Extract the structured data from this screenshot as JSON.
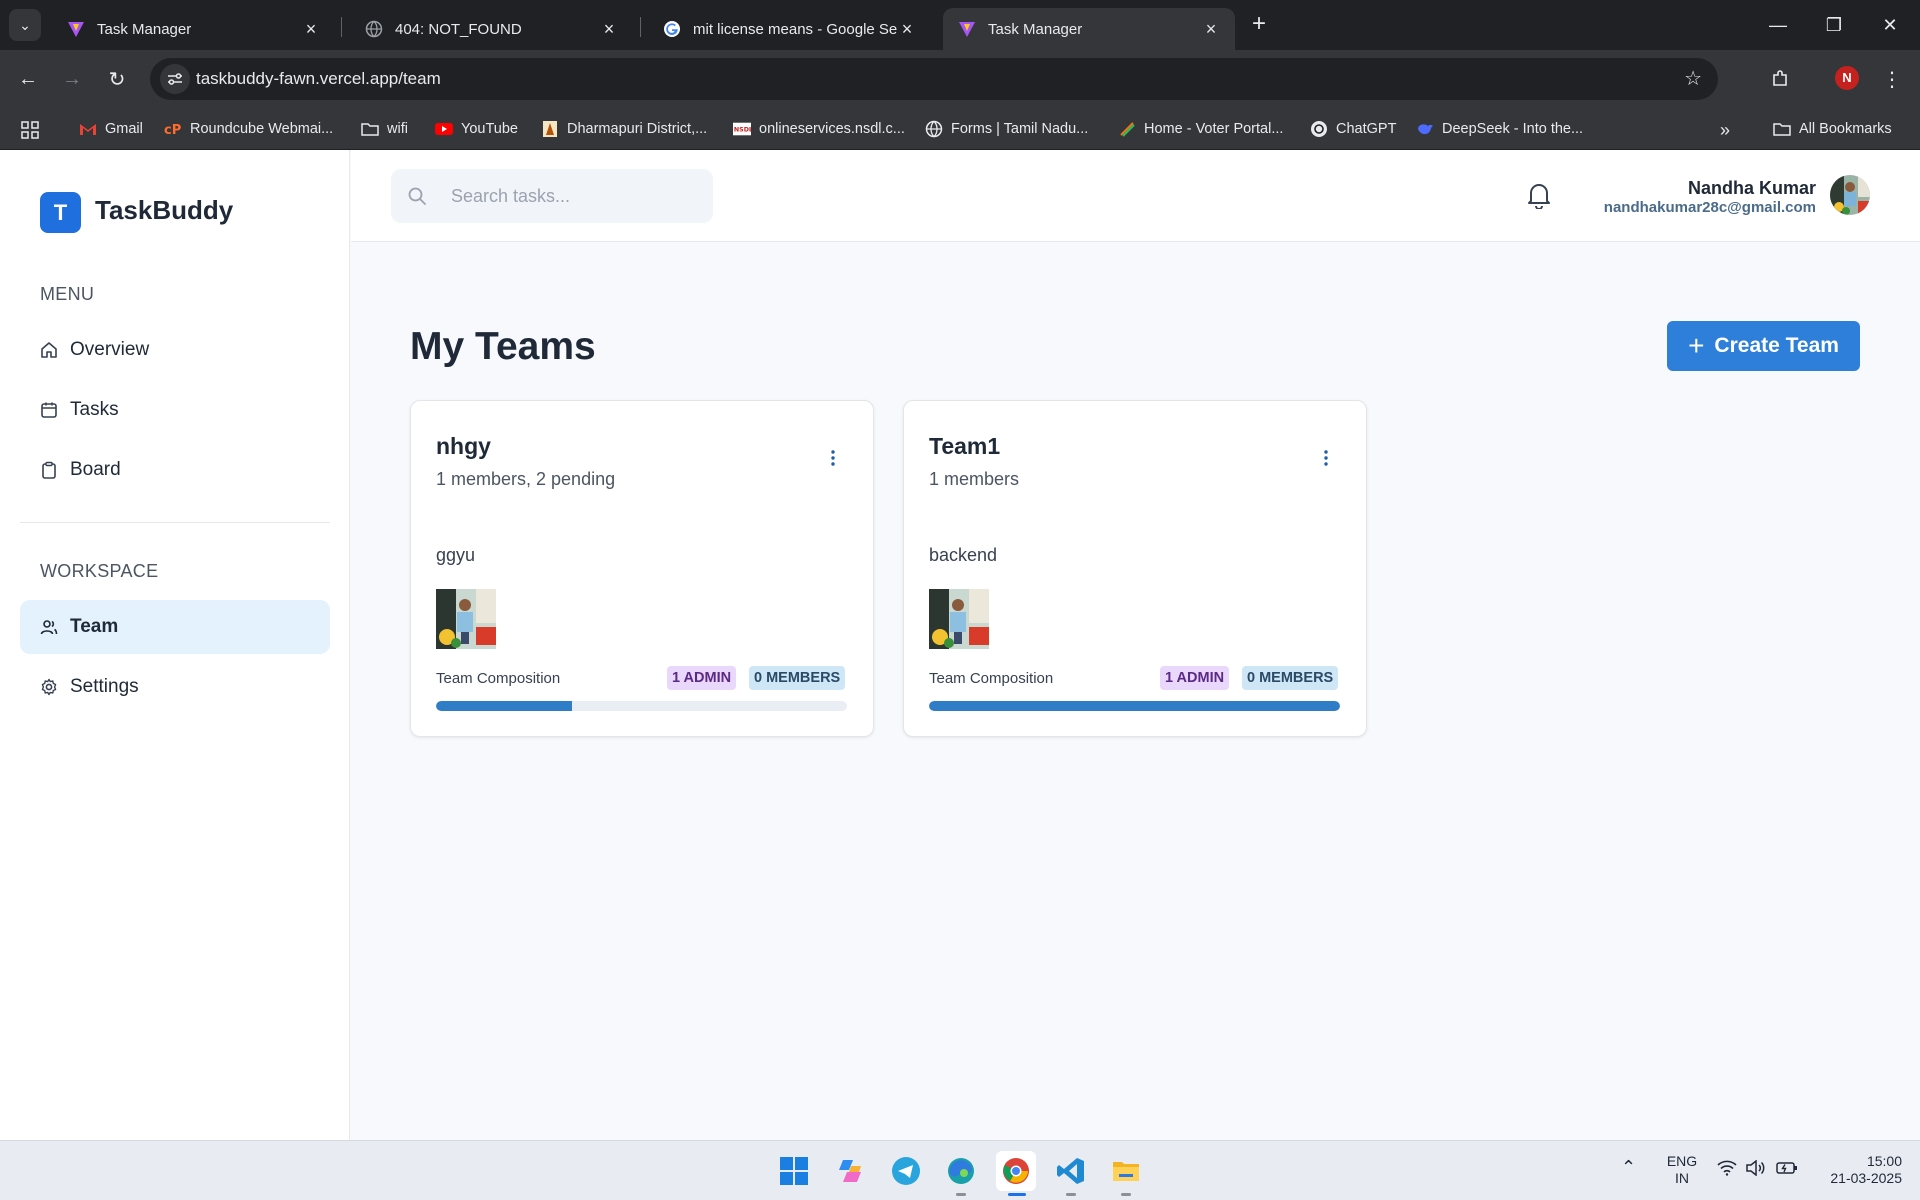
{
  "browser": {
    "tabs": [
      {
        "title": "Task Manager",
        "active": false
      },
      {
        "title": "404: NOT_FOUND",
        "active": false
      },
      {
        "title": "mit license means - Google Search",
        "active": false
      },
      {
        "title": "Task Manager",
        "active": true
      }
    ],
    "url": "taskbuddy-fawn.vercel.app/team",
    "profile_initial": "N",
    "bookmarks": [
      "Gmail",
      "Roundcube Webmai...",
      "wifi",
      "YouTube",
      "Dharmapuri District,...",
      "onlineservices.nsdl.c...",
      "Forms | Tamil Nadu...",
      "Home - Voter Portal...",
      "ChatGPT",
      "DeepSeek - Into the..."
    ],
    "all_bookmarks": "All Bookmarks"
  },
  "app": {
    "brand": "TaskBuddy",
    "brand_initial": "T",
    "menu_label": "MENU",
    "menu_items": [
      "Overview",
      "Tasks",
      "Board"
    ],
    "workspace_label": "WORKSPACE",
    "workspace_items": [
      "Team",
      "Settings"
    ],
    "active_item": "Team",
    "search_placeholder": "Search tasks...",
    "user": {
      "name": "Nandha Kumar",
      "email": "nandhakumar28c@gmail.com"
    },
    "page_title": "My Teams",
    "create_button": "Create Team",
    "teams": [
      {
        "name": "nhgy",
        "members_text": "1 members, 2 pending",
        "description": "ggyu",
        "composition_label": "Team Composition",
        "admin_badge": "1 ADMIN",
        "members_badge": "0 MEMBERS",
        "progress": 0.33
      },
      {
        "name": "Team1",
        "members_text": "1 members",
        "description": "backend",
        "composition_label": "Team Composition",
        "admin_badge": "1 ADMIN",
        "members_badge": "0 MEMBERS",
        "progress": 1.0
      }
    ]
  },
  "taskbar": {
    "language": "ENG",
    "region": "IN",
    "time": "15:00",
    "date": "21-03-2025"
  },
  "colors": {
    "accent": "#2d7fd9",
    "brand": "#1f6fde",
    "active_nav": "#e3f2fd"
  }
}
